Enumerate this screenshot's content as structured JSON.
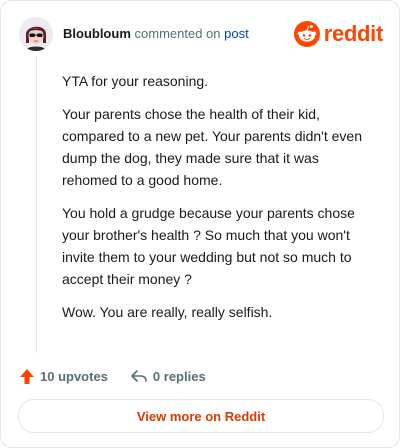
{
  "comment": {
    "author": "Bloubloum",
    "action_text": "commented on",
    "target_link": "post",
    "paragraphs": [
      "YTA for your reasoning.",
      "Your parents chose the health of their kid, compared to a new pet. Your parents didn't even dump the dog, they made sure that it was rehomed to a good home.",
      "You hold a grudge because your parents chose your brother's health ? So much that you won't invite them to your wedding but not so much to accept their money ?",
      "Wow. You are really, really selfish."
    ],
    "upvotes_label": "10 upvotes",
    "replies_label": "0 replies"
  },
  "brand": {
    "name": "reddit",
    "color": "#ff4500"
  },
  "cta": {
    "label": "View more on Reddit"
  },
  "icons": {
    "avatar": "user-avatar",
    "logo": "reddit-snoo-icon",
    "upvote": "upvote-arrow-icon",
    "reply": "reply-arrow-icon"
  }
}
